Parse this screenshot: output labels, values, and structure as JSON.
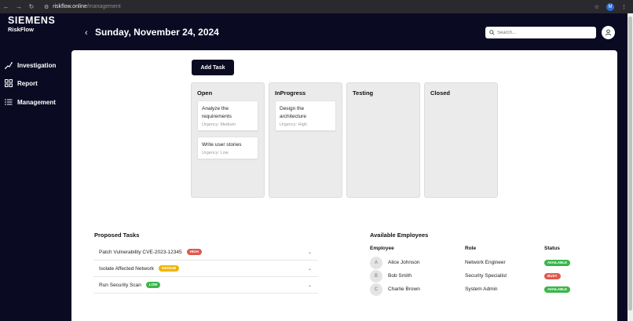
{
  "browser": {
    "url_host": "riskflow.online",
    "url_path": "/management",
    "profile_initial": "M"
  },
  "sidebar": {
    "brand": "SIEMENS",
    "product": "RiskFlow",
    "items": [
      {
        "label": "Investigation",
        "icon": "investigation-icon"
      },
      {
        "label": "Report",
        "icon": "report-icon"
      },
      {
        "label": "Management",
        "icon": "management-icon"
      }
    ]
  },
  "header": {
    "date": "Sunday, November 24, 2024",
    "search_placeholder": "Search..."
  },
  "board": {
    "add_task_label": "Add Task",
    "columns": [
      {
        "title": "Open",
        "cards": [
          {
            "title": "Analyze the requirements",
            "urgency": "Urgency: Medium"
          },
          {
            "title": "Write user stories",
            "urgency": "Urgency: Low"
          }
        ]
      },
      {
        "title": "InProgress",
        "cards": [
          {
            "title": "Design the architecture",
            "urgency": "Urgency: High"
          }
        ]
      },
      {
        "title": "Testing",
        "cards": []
      },
      {
        "title": "Closed",
        "cards": []
      }
    ]
  },
  "proposed_tasks": {
    "title": "Proposed Tasks",
    "items": [
      {
        "name": "Patch Vulnerability CVE-2023-12345",
        "priority": "HIGH",
        "color": "#e2574c"
      },
      {
        "name": "Isolate Affected Network",
        "priority": "MEDIUM",
        "color": "#f0b400"
      },
      {
        "name": "Run Security Scan",
        "priority": "LOW",
        "color": "#3bb54a"
      }
    ]
  },
  "employees": {
    "title": "Available Employees",
    "headers": [
      "Employee",
      "Role",
      "Status"
    ],
    "rows": [
      {
        "initial": "A",
        "name": "Alice Johnson",
        "role": "Network Engineer",
        "status": "AVAILABLE",
        "color": "#3bb54a"
      },
      {
        "initial": "B",
        "name": "Bob Smith",
        "role": "Security Specialist",
        "status": "BUSY",
        "color": "#e2574c"
      },
      {
        "initial": "C",
        "name": "Charlie Brown",
        "role": "System Admin",
        "status": "AVAILABLE",
        "color": "#3bb54a"
      }
    ]
  }
}
